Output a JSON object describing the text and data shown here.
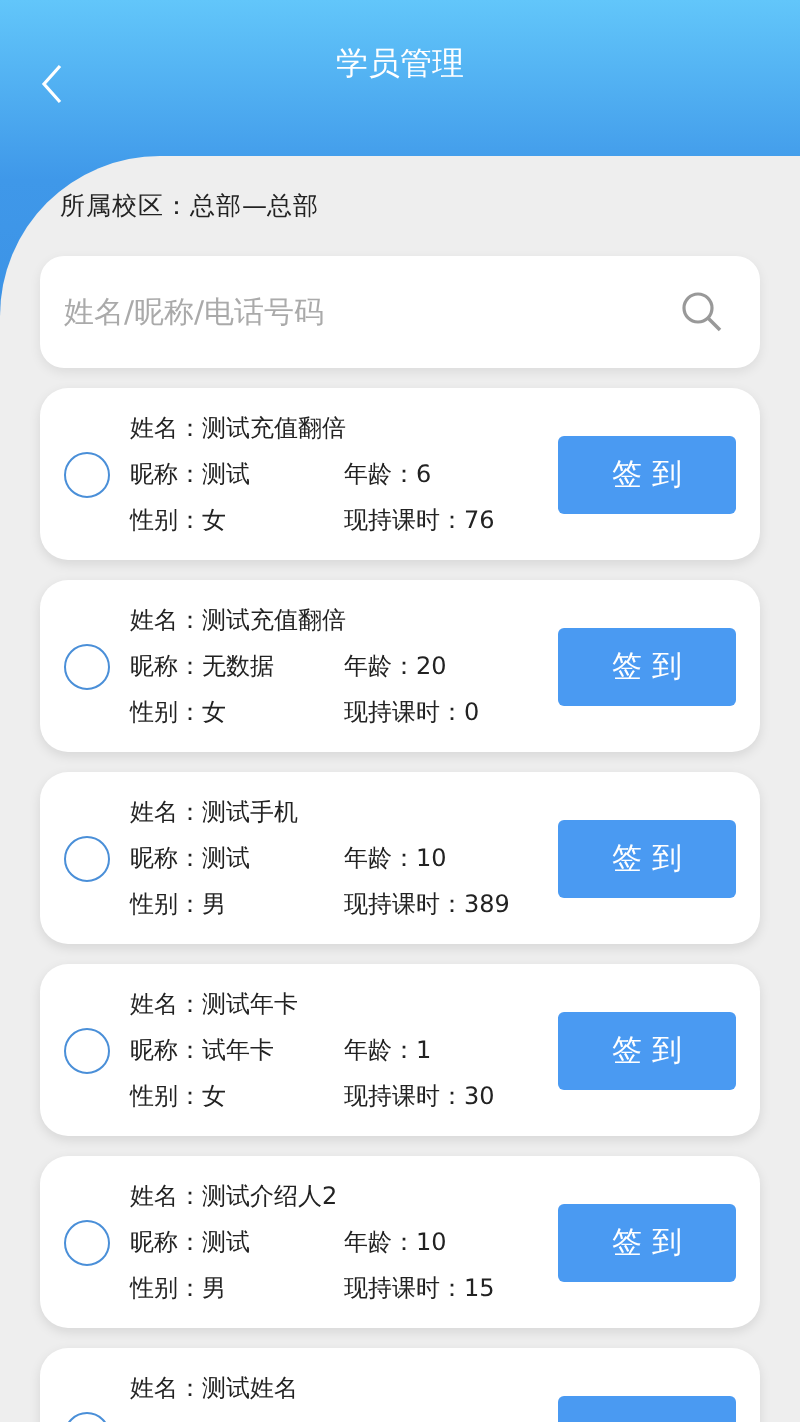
{
  "header": {
    "title": "学员管理"
  },
  "campus": "所属校区：总部—总部",
  "search": {
    "placeholder": "姓名/昵称/电话号码"
  },
  "students": [
    {
      "selected": false,
      "name": "姓名：测试充值翻倍",
      "nickname": "昵称：测试",
      "gender": "性别：女",
      "age": "年龄：6",
      "hours": "现持课时：76",
      "button": "签 到"
    },
    {
      "selected": false,
      "name": "姓名：测试充值翻倍",
      "nickname": "昵称：无数据",
      "gender": "性别：女",
      "age": "年龄：20",
      "hours": "现持课时：0",
      "button": "签 到"
    },
    {
      "selected": false,
      "name": "姓名：测试手机",
      "nickname": "昵称：测试",
      "gender": "性别：男",
      "age": "年龄：10",
      "hours": "现持课时：389",
      "button": "签 到"
    },
    {
      "selected": false,
      "name": "姓名：测试年卡",
      "nickname": "昵称：试年卡",
      "gender": "性别：女",
      "age": "年龄：1",
      "hours": "现持课时：30",
      "button": "签 到"
    },
    {
      "selected": false,
      "name": "姓名：测试介绍人2",
      "nickname": "昵称：测试",
      "gender": "性别：男",
      "age": "年龄：10",
      "hours": "现持课时：15",
      "button": "签 到"
    },
    {
      "selected": false,
      "name": "姓名：测试姓名"
    }
  ]
}
